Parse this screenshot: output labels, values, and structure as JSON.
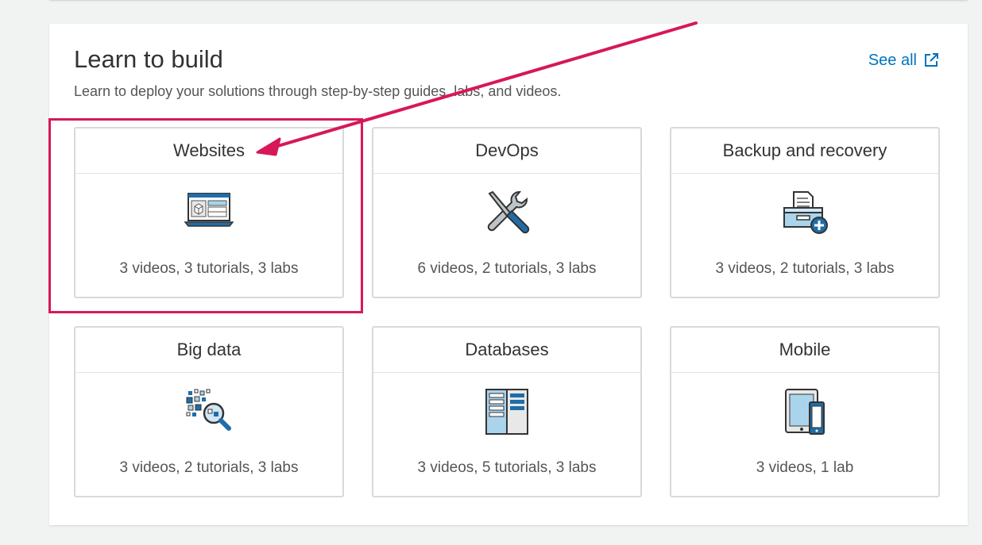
{
  "section": {
    "title": "Learn to build",
    "subtitle": "Learn to deploy your solutions through step-by-step guides, labs, and videos.",
    "see_all_label": "See all",
    "see_all_icon": "external-link-icon"
  },
  "cards": [
    {
      "title": "Websites",
      "meta": "3 videos, 3 tutorials, 3 labs",
      "icon": "website-laptop-icon"
    },
    {
      "title": "DevOps",
      "meta": "6 videos, 2 tutorials, 3 labs",
      "icon": "tools-icon"
    },
    {
      "title": "Backup and recovery",
      "meta": "3 videos, 2 tutorials, 3 labs",
      "icon": "backup-archive-icon"
    },
    {
      "title": "Big data",
      "meta": "3 videos, 2 tutorials, 3 labs",
      "icon": "big-data-magnifier-icon"
    },
    {
      "title": "Databases",
      "meta": "3 videos, 5 tutorials, 3 labs",
      "icon": "database-server-icon"
    },
    {
      "title": "Mobile",
      "meta": "3 videos, 1 lab",
      "icon": "mobile-devices-icon"
    }
  ],
  "colors": {
    "link": "#0073bb",
    "annotation": "#d6185a",
    "card_border": "#d5dbdb",
    "icon_blue": "#1f6da8",
    "icon_light_blue": "#a9d4ec"
  }
}
